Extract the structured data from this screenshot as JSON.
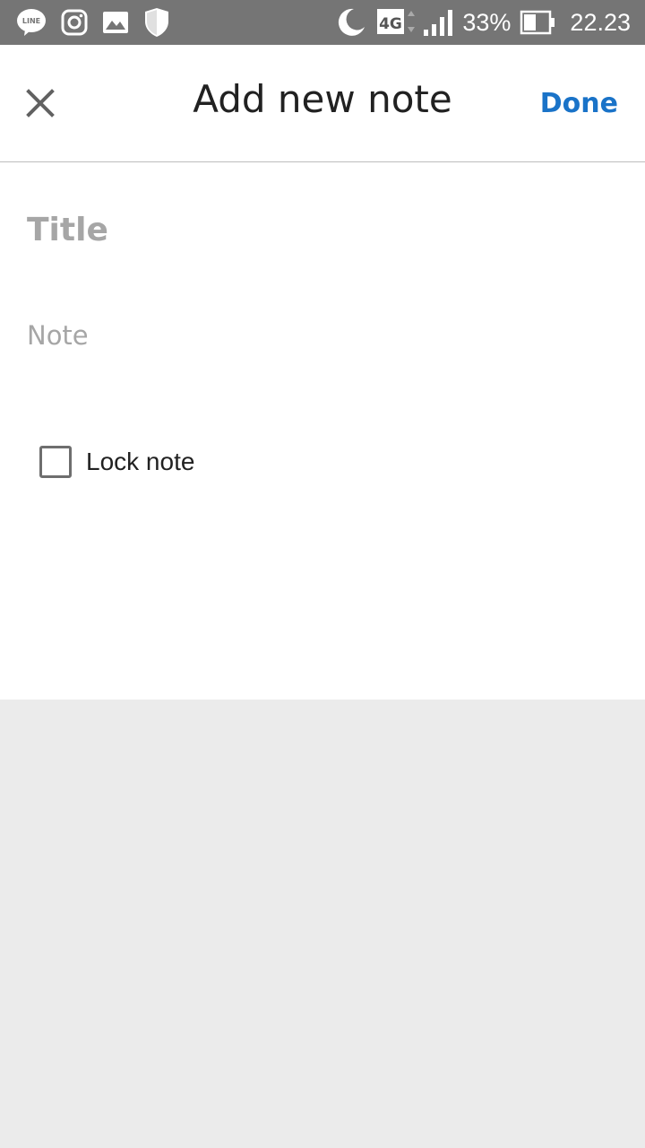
{
  "status_bar": {
    "left_icons": [
      "line-icon",
      "instagram-icon",
      "gallery-icon",
      "shield-icon"
    ],
    "right_icons": [
      "moon-icon",
      "network-4g-icon",
      "signal-icon",
      "battery-icon"
    ],
    "network_type": "4G",
    "battery_percent": "33%",
    "time": "22.23"
  },
  "header": {
    "title": "Add new note",
    "done_label": "Done",
    "close_icon": "close-icon"
  },
  "form": {
    "title_placeholder": "Title",
    "title_value": "",
    "note_placeholder": "Note",
    "note_value": "",
    "lock_label": "Lock note",
    "lock_checked": false
  },
  "colors": {
    "status_bar": "#757575",
    "accent": "#1a73c8",
    "background": "#ebebeb"
  }
}
